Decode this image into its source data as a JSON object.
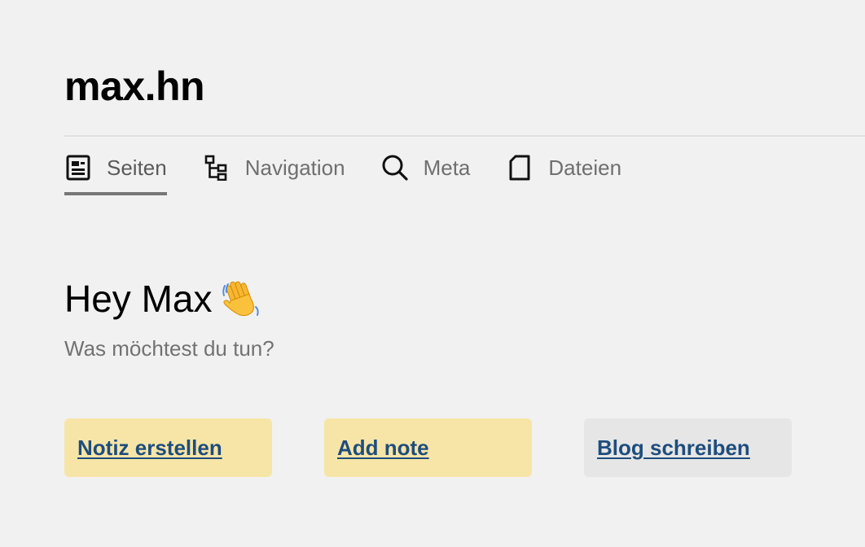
{
  "site": {
    "title": "max.hn"
  },
  "tabs": [
    {
      "label": "Seiten",
      "icon": "document-list-icon",
      "active": true
    },
    {
      "label": "Navigation",
      "icon": "tree-structure-icon",
      "active": false
    },
    {
      "label": "Meta",
      "icon": "search-icon",
      "active": false
    },
    {
      "label": "Dateien",
      "icon": "file-icon",
      "active": false
    }
  ],
  "main": {
    "greeting": "Hey Max",
    "greeting_icon": "waving-hand-icon",
    "subtitle": "Was möchtest du tun?",
    "actions": [
      {
        "label": "Notiz erstellen",
        "color": "#f7e5a7"
      },
      {
        "label": "Add note",
        "color": "#f7e5a7"
      },
      {
        "label": "Blog schreiben",
        "color": "#e6e6e6"
      }
    ]
  },
  "colors": {
    "background": "#f1f1f1",
    "link": "#1e4d7d",
    "muted_text": "#727272"
  }
}
